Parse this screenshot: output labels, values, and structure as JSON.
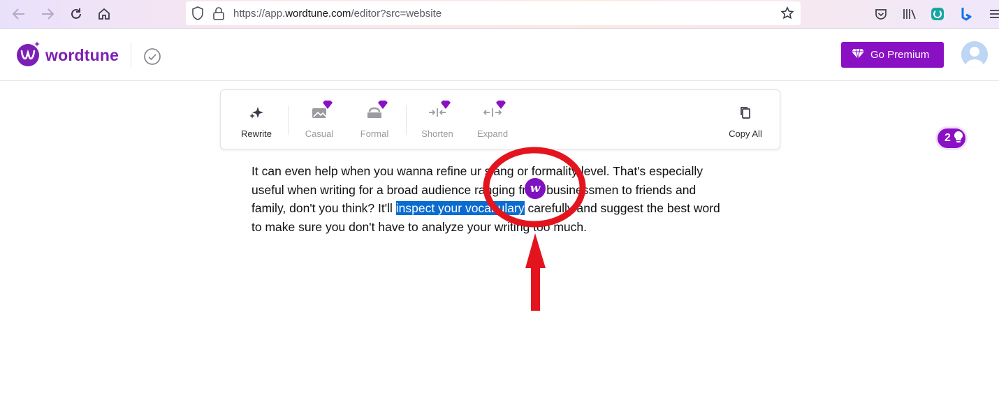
{
  "browser": {
    "url_prefix": "https://app.",
    "url_domain": "wordtune.com",
    "url_suffix": "/editor?src=website"
  },
  "header": {
    "logo_text": "wordtune",
    "premium_label": "Go Premium"
  },
  "toolbar": {
    "tools": [
      {
        "label": "Rewrite",
        "icon": "sparkles-icon",
        "premium": false
      },
      {
        "label": "Casual",
        "icon": "casual-icon",
        "premium": true
      },
      {
        "label": "Formal",
        "icon": "formal-icon",
        "premium": true
      },
      {
        "label": "Shorten",
        "icon": "shorten-icon",
        "premium": true
      },
      {
        "label": "Expand",
        "icon": "expand-icon",
        "premium": true
      },
      {
        "label": "Copy All",
        "icon": "copy-icon",
        "premium": false
      }
    ]
  },
  "suggestions_badge": {
    "count": "2"
  },
  "editor": {
    "line1": "It can even help when you wanna refine ur slang or formality level. That's especially",
    "line2": "useful when writing for a broad audience ranging from businessmen to friends and",
    "line3_before": "family, don't you think? It'll ",
    "line3_selected": "inspect your vocabulary",
    "line3_after": " carefully and suggest the best word",
    "line4": "to make sure you don't have to analyze your writing too much."
  },
  "colors": {
    "brand": "#8a10c4",
    "selection": "#0a6bd0",
    "annotation": "#e3141e"
  }
}
